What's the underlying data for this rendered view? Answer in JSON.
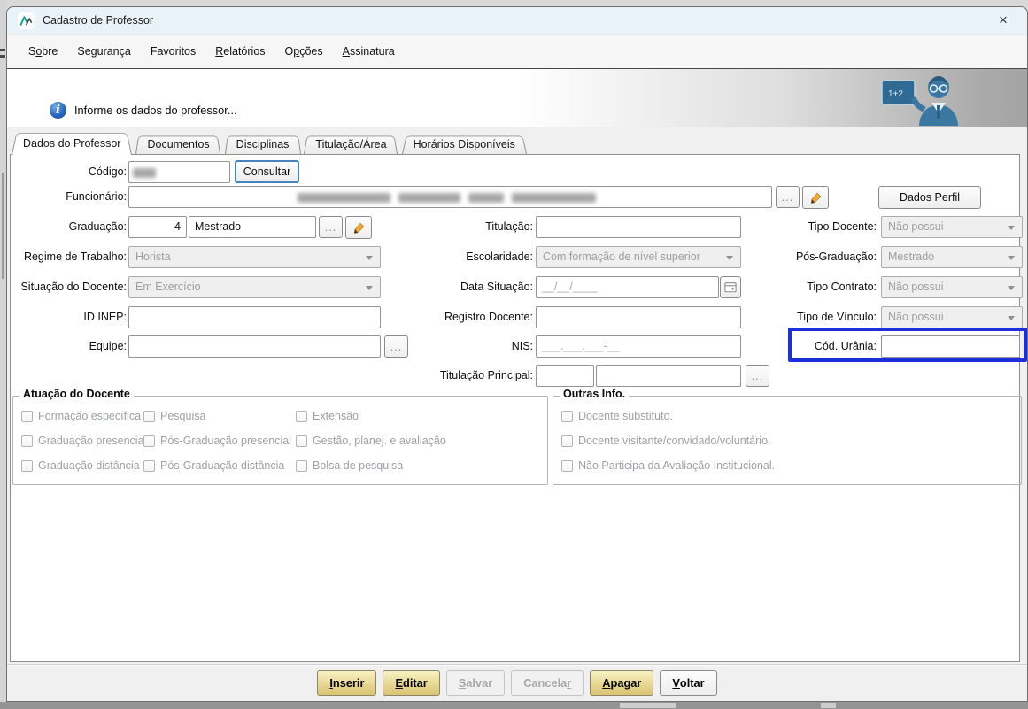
{
  "window": {
    "title": "Cadastro de Professor",
    "close": "×"
  },
  "menu": {
    "items": [
      {
        "pre": "S",
        "mn": "o",
        "post": "bre"
      },
      {
        "pre": "Segurança",
        "mn": "",
        "post": ""
      },
      {
        "pre": "Favoritos",
        "mn": "",
        "post": ""
      },
      {
        "pre": "",
        "mn": "R",
        "post": "elatórios"
      },
      {
        "pre": "O",
        "mn": "p",
        "post": "ções"
      },
      {
        "pre": "",
        "mn": "A",
        "post": "ssinatura"
      }
    ]
  },
  "header": {
    "message": "Informe os dados do professor...",
    "info_glyph": "i",
    "board_text": "1+2"
  },
  "tabs": [
    {
      "label": "Dados do Professor"
    },
    {
      "label": "Documentos"
    },
    {
      "label": "Disciplinas"
    },
    {
      "label": "Titulação/Área"
    },
    {
      "label": "Horários Disponíveis"
    }
  ],
  "form": {
    "codigo_label": "Código:",
    "consultar_button": "Consultar",
    "funcionario_label": "Funcionário:",
    "ellipsis": "...",
    "dados_perfil_button": "Dados Perfil",
    "graduacao_label": "Graduação:",
    "graduacao_codigo": "4",
    "graduacao_nome": "Mestrado",
    "titulacao_label": "Titulação:",
    "titulacao_value": "",
    "tipo_docente_label": "Tipo Docente:",
    "tipo_docente_value": "Não possui",
    "regime_label": "Regime de Trabalho:",
    "regime_value": "Horista",
    "escolaridade_label": "Escolaridade:",
    "escolaridade_value": "Com formação de nível superior",
    "pos_graduacao_label": "Pós-Graduação:",
    "pos_graduacao_value": "Mestrado",
    "situacao_label": "Situação do Docente:",
    "situacao_value": "Em Exercício",
    "data_situacao_label": "Data Situação:",
    "data_situacao_mask": "__/__/____",
    "tipo_contrato_label": "Tipo Contrato:",
    "tipo_contrato_value": "Não possui",
    "id_inep_label": "ID INEP:",
    "id_inep_value": "",
    "registro_docente_label": "Registro Docente:",
    "registro_docente_value": "",
    "tipo_vinculo_label": "Tipo de Vínculo:",
    "tipo_vinculo_value": "Não possui",
    "equipe_label": "Equipe:",
    "equipe_value": "",
    "nis_label": "NIS:",
    "nis_mask": "___.___.___-__",
    "cod_urania_label": "Cód. Urânia:",
    "cod_urania_value": "",
    "titulacao_principal_label": "Titulação Principal:",
    "titulacao_principal_value1": "",
    "titulacao_principal_value2": ""
  },
  "groups": {
    "atuacao_title": "Atuação do Docente",
    "atuacao_items": [
      "Formação específica",
      "Graduação presencial",
      "Graduação distância",
      "Pesquisa",
      "Pós-Graduação presencial",
      "Pós-Graduação distância",
      "Extensão",
      "Gestão, planej. e avaliação",
      "Bolsa de pesquisa"
    ],
    "outras_title": "Outras Info.",
    "outras_items": [
      "Docente substituto.",
      "Docente visitante/convidado/voluntário.",
      "Não Participa da Avaliação Institucional."
    ]
  },
  "footer": {
    "buttons": [
      {
        "pre": "",
        "mn": "I",
        "post": "nserir"
      },
      {
        "pre": "",
        "mn": "E",
        "post": "ditar"
      },
      {
        "pre": "",
        "mn": "S",
        "post": "alvar"
      },
      {
        "pre": "Cancela",
        "mn": "r",
        "post": ""
      },
      {
        "pre": "",
        "mn": "A",
        "post": "pagar"
      },
      {
        "pre": "",
        "mn": "V",
        "post": "oltar"
      }
    ]
  }
}
